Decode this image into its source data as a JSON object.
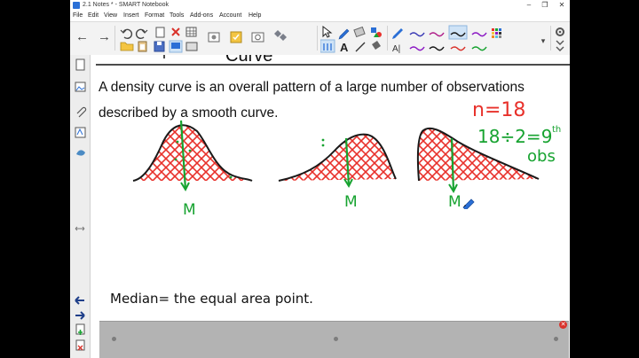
{
  "window": {
    "title": "2.1 Notes * - SMART Notebook",
    "minimize": "–",
    "restore": "❐",
    "close": "✕"
  },
  "menu": [
    "File",
    "Edit",
    "View",
    "Insert",
    "Format",
    "Tools",
    "Add-ons",
    "Account",
    "Help"
  ],
  "toolbar": {
    "back": "←",
    "forward": "→",
    "text_tool": "A",
    "text_style": "A|",
    "pen_colors": [
      "#3b3bb5",
      "#b0208a",
      "#8c1ac4",
      "#1a1a1a"
    ],
    "more": "▾"
  },
  "slide": {
    "heading_fragment": "Curve",
    "definition_line1": "A density curve is an overall pattern of a large number of observations",
    "definition_line2": "described by a smooth curve.",
    "median_statement": "Median= the equal area point.",
    "median_labels": [
      "M",
      "M",
      "M"
    ],
    "annotation_n": "n=18",
    "annotation_calc": "18÷2=9",
    "annotation_th": "th",
    "annotation_obs": "obs"
  },
  "colors": {
    "hatch_red": "#e8312b",
    "annotation_green": "#17a330",
    "curve_black": "#1a1a1a",
    "gallery_gray": "#b3b3b3"
  }
}
